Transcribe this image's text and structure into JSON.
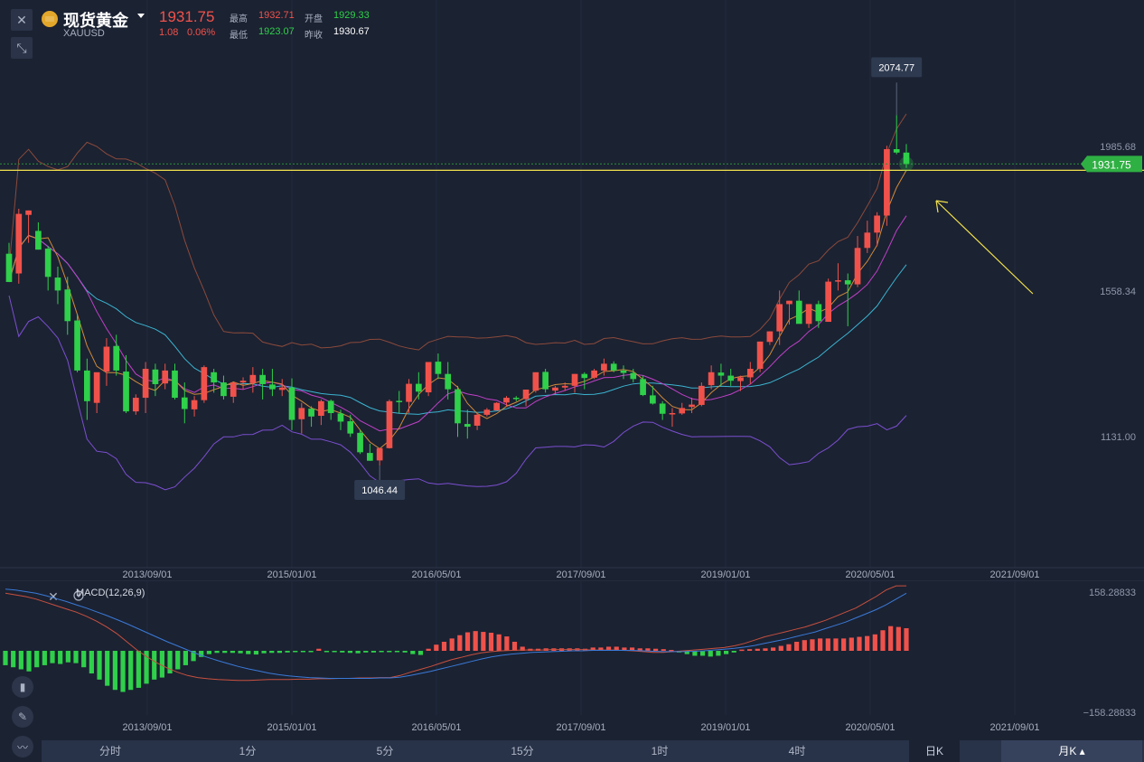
{
  "header": {
    "close_icon": "close-x-icon",
    "collapse_icon": "collapse-arrows-icon",
    "title": "现货黄金",
    "symbol": "XAUUSD",
    "last_price": "1931.75",
    "change": "1.08",
    "change_pct": "0.06%",
    "high_label": "最高",
    "high": "1932.71",
    "open_label": "开盘",
    "open": "1929.33",
    "low_label": "最低",
    "low": "1923.07",
    "prev_label": "昨收",
    "prev": "1930.67"
  },
  "colors": {
    "up": "#f0524b",
    "down": "#2fd04a",
    "background": "#1b2232",
    "highlight_line": "#f2e14c"
  },
  "chart_data": [
    {
      "type": "candlestick",
      "interval": "月K",
      "x_ticks": [
        "2013/09/01",
        "2015/01/01",
        "2016/05/01",
        "2017/09/01",
        "2019/01/01",
        "2020/05/01",
        "2021/09/01"
      ],
      "y_ticks": [
        "1985.68",
        "1558.34",
        "1131.00"
      ],
      "ylim": [
        800,
        2200
      ],
      "last_price_tag": "1931.75",
      "max_marker": "2074.77",
      "min_marker": "1046.44",
      "horizontal_line": 1913,
      "candles": [
        [
          1668,
          1700,
          1600,
          1585
        ],
        [
          1610,
          1800,
          1580,
          1785
        ],
        [
          1782,
          1795,
          1700,
          1795
        ],
        [
          1735,
          1760,
          1680,
          1680
        ],
        [
          1683,
          1690,
          1560,
          1600
        ],
        [
          1598,
          1630,
          1520,
          1560
        ],
        [
          1563,
          1600,
          1430,
          1470
        ],
        [
          1472,
          1490,
          1320,
          1325
        ],
        [
          1325,
          1360,
          1180,
          1235
        ],
        [
          1230,
          1260,
          1200,
          1320
        ],
        [
          1322,
          1420,
          1280,
          1395
        ],
        [
          1397,
          1430,
          1310,
          1325
        ],
        [
          1322,
          1370,
          1200,
          1205
        ],
        [
          1205,
          1255,
          1195,
          1245
        ],
        [
          1245,
          1350,
          1200,
          1330
        ],
        [
          1328,
          1345,
          1250,
          1285
        ],
        [
          1287,
          1345,
          1270,
          1325
        ],
        [
          1325,
          1345,
          1240,
          1245
        ],
        [
          1246,
          1290,
          1170,
          1212
        ],
        [
          1211,
          1250,
          1190,
          1238
        ],
        [
          1238,
          1340,
          1230,
          1335
        ],
        [
          1320,
          1330,
          1260,
          1290
        ],
        [
          1290,
          1310,
          1240,
          1250
        ],
        [
          1248,
          1290,
          1230,
          1290
        ],
        [
          1290,
          1305,
          1270,
          1295
        ],
        [
          1288,
          1335,
          1260,
          1312
        ],
        [
          1312,
          1330,
          1240,
          1285
        ],
        [
          1284,
          1330,
          1250,
          1270
        ],
        [
          1268,
          1300,
          1250,
          1275
        ],
        [
          1275,
          1302,
          1150,
          1180
        ],
        [
          1182,
          1230,
          1140,
          1215
        ],
        [
          1213,
          1220,
          1160,
          1190
        ],
        [
          1192,
          1240,
          1165,
          1235
        ],
        [
          1236,
          1240,
          1180,
          1200
        ],
        [
          1199,
          1210,
          1150,
          1175
        ],
        [
          1176,
          1195,
          1130,
          1140
        ],
        [
          1142,
          1150,
          1080,
          1085
        ],
        [
          1083,
          1110,
          1060,
          1060
        ],
        [
          1061,
          1075,
          1046,
          1097
        ],
        [
          1097,
          1240,
          1096,
          1235
        ],
        [
          1236,
          1265,
          1200,
          1235
        ],
        [
          1233,
          1300,
          1200,
          1286
        ],
        [
          1286,
          1320,
          1240,
          1263
        ],
        [
          1261,
          1340,
          1250,
          1350
        ],
        [
          1351,
          1375,
          1300,
          1315
        ],
        [
          1315,
          1350,
          1240,
          1270
        ],
        [
          1270,
          1280,
          1130,
          1170
        ],
        [
          1168,
          1210,
          1125,
          1160
        ],
        [
          1163,
          1200,
          1150,
          1195
        ],
        [
          1195,
          1215,
          1190,
          1210
        ],
        [
          1208,
          1232,
          1220,
          1230
        ],
        [
          1231,
          1250,
          1220,
          1245
        ],
        [
          1245,
          1250,
          1235,
          1242
        ],
        [
          1241,
          1250,
          1220,
          1269
        ],
        [
          1266,
          1310,
          1260,
          1320
        ],
        [
          1321,
          1330,
          1260,
          1270
        ],
        [
          1266,
          1280,
          1255,
          1275
        ],
        [
          1275,
          1290,
          1265,
          1280
        ],
        [
          1280,
          1315,
          1260,
          1315
        ],
        [
          1315,
          1320,
          1270,
          1303
        ],
        [
          1304,
          1330,
          1300,
          1325
        ],
        [
          1325,
          1360,
          1310,
          1345
        ],
        [
          1345,
          1352,
          1320,
          1325
        ],
        [
          1325,
          1340,
          1300,
          1318
        ],
        [
          1318,
          1330,
          1290,
          1300
        ],
        [
          1300,
          1310,
          1250,
          1253
        ],
        [
          1252,
          1280,
          1225,
          1228
        ],
        [
          1228,
          1235,
          1180,
          1198
        ],
        [
          1198,
          1215,
          1160,
          1200
        ],
        [
          1199,
          1230,
          1195,
          1215
        ],
        [
          1218,
          1245,
          1200,
          1225
        ],
        [
          1224,
          1290,
          1220,
          1280
        ],
        [
          1282,
          1340,
          1270,
          1320
        ],
        [
          1319,
          1345,
          1280,
          1310
        ],
        [
          1310,
          1330,
          1280,
          1295
        ],
        [
          1294,
          1310,
          1265,
          1305
        ],
        [
          1305,
          1350,
          1285,
          1330
        ],
        [
          1330,
          1410,
          1320,
          1410
        ],
        [
          1409,
          1440,
          1400,
          1440
        ],
        [
          1440,
          1560,
          1400,
          1520
        ],
        [
          1520,
          1530,
          1460,
          1530
        ],
        [
          1530,
          1560,
          1470,
          1462
        ],
        [
          1462,
          1520,
          1450,
          1520
        ],
        [
          1520,
          1530,
          1450,
          1470
        ],
        [
          1468,
          1595,
          1470,
          1586
        ],
        [
          1589,
          1640,
          1560,
          1590
        ],
        [
          1590,
          1610,
          1455,
          1578
        ],
        [
          1578,
          1720,
          1570,
          1685
        ],
        [
          1685,
          1765,
          1670,
          1730
        ],
        [
          1730,
          1790,
          1690,
          1780
        ],
        [
          1780,
          1985,
          1750,
          1975
        ],
        [
          1975,
          2075,
          1960,
          1965
        ],
        [
          1965,
          1990,
          1920,
          1931.75
        ]
      ]
    },
    {
      "type": "macd",
      "label": "MACD(12,26,9)",
      "y_ticks": [
        "158.28833",
        "−158.28833"
      ],
      "ylim": [
        -158.28833,
        158.28833
      ],
      "x_ticks": [
        "2013/09/01",
        "2015/01/01",
        "2016/05/01",
        "2017/09/01",
        "2019/01/01",
        "2020/05/01",
        "2021/09/01"
      ],
      "histogram": [
        -35,
        -40,
        -45,
        -50,
        -40,
        -35,
        -30,
        -32,
        -28,
        -30,
        -40,
        -55,
        -70,
        -85,
        -95,
        -100,
        -95,
        -90,
        -80,
        -70,
        -65,
        -55,
        -45,
        -35,
        -25,
        -15,
        -8,
        -5,
        -5,
        -5,
        -6,
        -8,
        -9,
        -6,
        -5,
        -5,
        -4,
        -3,
        -2,
        -3,
        5,
        -3,
        -3,
        -4,
        -5,
        -6,
        -4,
        -4,
        -2,
        -3,
        -2,
        -4,
        -8,
        -10,
        5,
        15,
        22,
        30,
        38,
        45,
        48,
        46,
        44,
        40,
        35,
        22,
        10,
        5,
        5,
        6,
        6,
        6,
        6,
        6,
        5,
        8,
        8,
        10,
        10,
        8,
        8,
        6,
        6,
        5,
        4,
        2,
        -4,
        -8,
        -12,
        -12,
        -14,
        -12,
        -8,
        -4,
        3,
        4,
        5,
        6,
        8,
        12,
        16,
        22,
        26,
        28,
        30,
        30,
        30,
        30,
        32,
        34,
        36,
        40,
        50,
        60,
        58,
        55
      ],
      "dif": [
        140,
        136,
        132,
        126,
        118,
        110,
        102,
        94,
        84,
        72,
        58,
        42,
        22,
        2,
        -15,
        -30,
        -42,
        -52,
        -60,
        -65,
        -68,
        -70,
        -71,
        -72,
        -72,
        -71,
        -70,
        -70,
        -70,
        -69,
        -69,
        -68,
        -68,
        -67,
        -67,
        -66,
        -66,
        -65,
        -65,
        -60,
        -52,
        -45,
        -38,
        -30,
        -22,
        -16,
        -10,
        -5,
        -2,
        0,
        1,
        2,
        2,
        2,
        3,
        3,
        3,
        3,
        2,
        2,
        2,
        1,
        0,
        -2,
        -4,
        -4,
        -2,
        0,
        2,
        4,
        6,
        8,
        12,
        18,
        26,
        34,
        40,
        46,
        52,
        58,
        66,
        74,
        84,
        94,
        104,
        118,
        132,
        148,
        158,
        158
      ],
      "dea": [
        150,
        148,
        144,
        140,
        134,
        127,
        120,
        112,
        104,
        95,
        86,
        76,
        66,
        55,
        44,
        33,
        22,
        12,
        2,
        -8,
        -16,
        -24,
        -31,
        -38,
        -44,
        -49,
        -54,
        -58,
        -61,
        -63,
        -65,
        -66,
        -67,
        -67,
        -67,
        -67,
        -67,
        -66,
        -66,
        -64,
        -60,
        -55,
        -50,
        -44,
        -38,
        -32,
        -26,
        -20,
        -15,
        -11,
        -8,
        -6,
        -4,
        -3,
        -2,
        -1,
        0,
        0,
        1,
        1,
        1,
        1,
        1,
        0,
        -1,
        -2,
        -2,
        -2,
        -1,
        0,
        2,
        4,
        6,
        9,
        13,
        18,
        23,
        28,
        34,
        40,
        46,
        54,
        62,
        70,
        80,
        90,
        100,
        112,
        126,
        140
      ]
    }
  ],
  "panel_icons": {
    "close": "close-x-icon",
    "settings": "settings-gear-icon"
  },
  "side_tools": [
    "candlestick-icon",
    "pencil-draw-icon",
    "indicator-wave-icon"
  ],
  "timeframes": [
    "分时",
    "1分",
    "5分",
    "15分",
    "1时",
    "4时",
    "日K",
    "月K"
  ],
  "active_timeframe": "月K"
}
